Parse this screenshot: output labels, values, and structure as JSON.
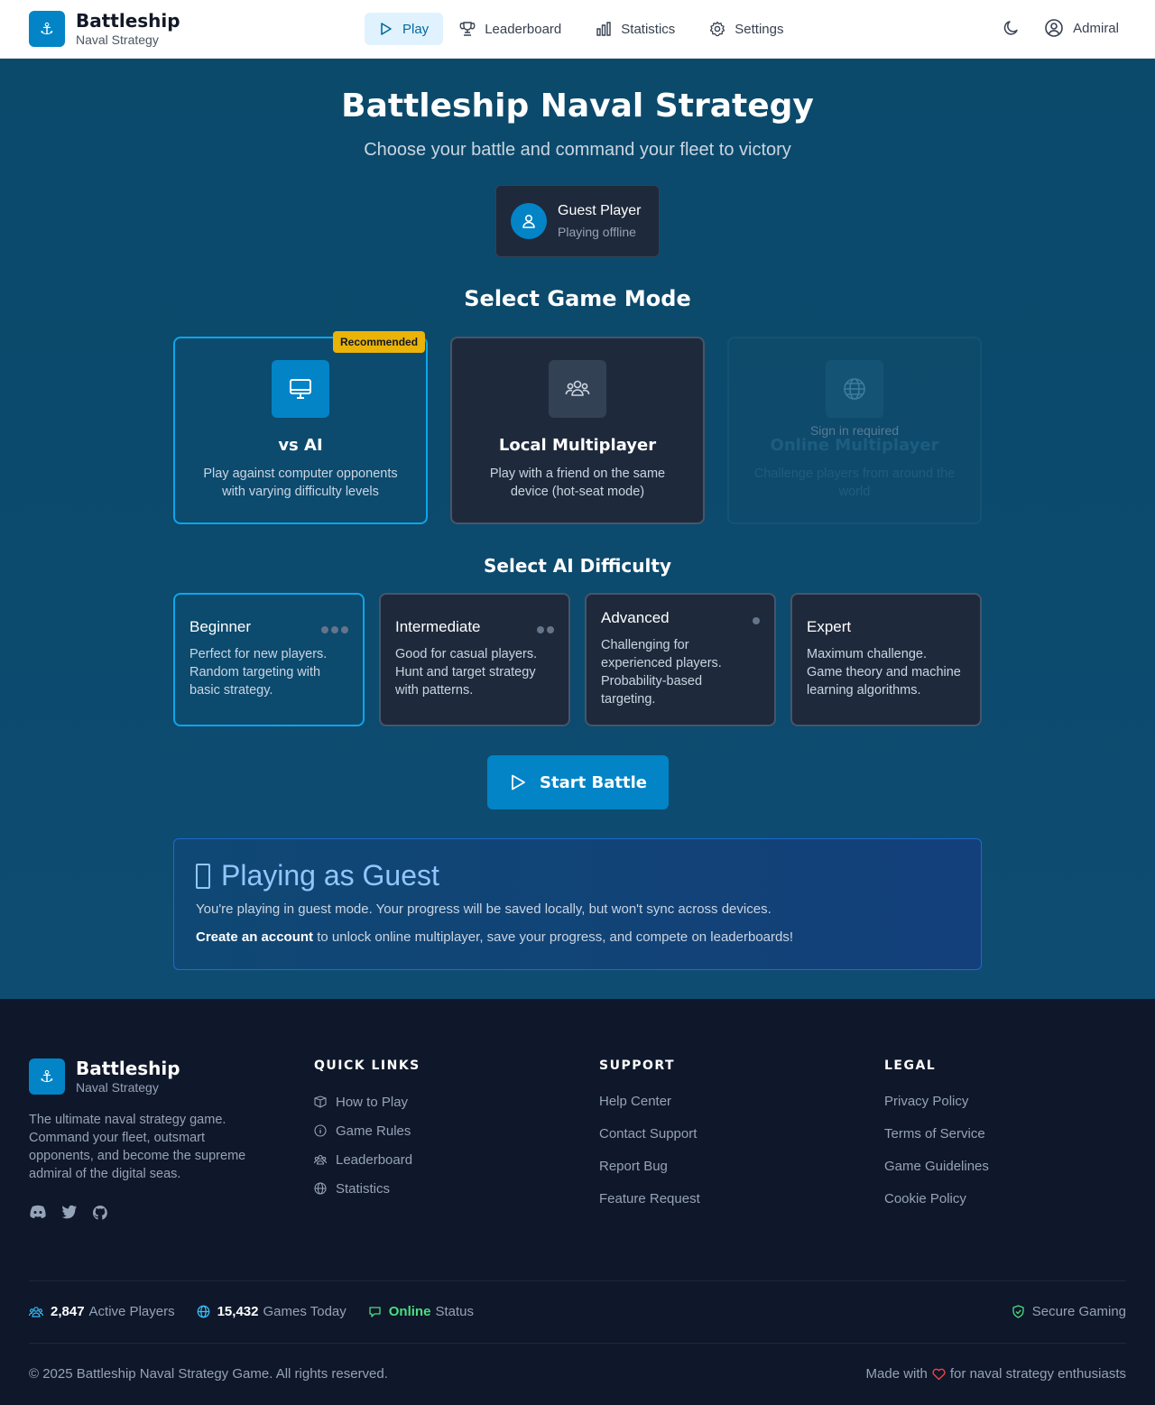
{
  "header": {
    "brand_title": "Battleship",
    "brand_sub": "Naval Strategy",
    "logo_glyph": "⚓",
    "nav": [
      {
        "label": "Play",
        "icon": "play-icon",
        "active": true
      },
      {
        "label": "Leaderboard",
        "icon": "trophy-icon"
      },
      {
        "label": "Statistics",
        "icon": "bar-chart-icon"
      },
      {
        "label": "Settings",
        "icon": "gear-icon"
      }
    ],
    "user_label": "Admiral"
  },
  "hero": {
    "title": "Battleship Naval Strategy",
    "subtitle": "Choose your battle and command your fleet to victory"
  },
  "guest": {
    "name": "Guest Player",
    "status": "Playing offline"
  },
  "modes_title": "Select Game Mode",
  "modes": [
    {
      "title": "vs AI",
      "desc": "Play against computer opponents with varying difficulty levels",
      "badge": "Recommended",
      "icon": "monitor-icon",
      "selected": true
    },
    {
      "title": "Local Multiplayer",
      "desc": "Play with a friend on the same device (hot-seat mode)",
      "icon": "users-icon"
    },
    {
      "title": "Online Multiplayer",
      "desc": "Challenge players from around the world",
      "note": "Sign in required",
      "icon": "globe-icon",
      "disabled": true
    }
  ],
  "difficulty_title": "Select AI Difficulty",
  "difficulties": [
    {
      "name": "Beginner",
      "desc": "Perfect for new players. Random targeting with basic strategy.",
      "dots": 3,
      "selected": true
    },
    {
      "name": "Intermediate",
      "desc": "Good for casual players. Hunt and target strategy with patterns.",
      "dots": 2
    },
    {
      "name": "Advanced",
      "desc": "Challenging for experienced players. Probability-based targeting.",
      "dots": 1
    },
    {
      "name": "Expert",
      "desc": "Maximum challenge. Game theory and machine learning algorithms.",
      "dots": 0
    }
  ],
  "start_button": "Start Battle",
  "info": {
    "title": "Playing as Guest",
    "line1": "You're playing in guest mode. Your progress will be saved locally, but won't sync across devices.",
    "link": "Create an account",
    "line2_rest": " to unlock online multiplayer, save your progress, and compete on leaderboards!"
  },
  "footer": {
    "brand_title": "Battleship",
    "brand_sub": "Naval Strategy",
    "desc": "The ultimate naval strategy game. Command your fleet, outsmart opponents, and become the supreme admiral of the digital seas.",
    "socials": [
      "discord-icon",
      "twitter-icon",
      "github-icon"
    ],
    "quick_links_title": "QUICK LINKS",
    "quick_links": [
      {
        "label": "How to Play",
        "icon": "book-icon"
      },
      {
        "label": "Game Rules",
        "icon": "info-icon"
      },
      {
        "label": "Leaderboard",
        "icon": "users-icon"
      },
      {
        "label": "Statistics",
        "icon": "globe-icon"
      }
    ],
    "support_title": "SUPPORT",
    "support": [
      "Help Center",
      "Contact Support",
      "Report Bug",
      "Feature Request"
    ],
    "legal_title": "LEGAL",
    "legal": [
      "Privacy Policy",
      "Terms of Service",
      "Game Guidelines",
      "Cookie Policy"
    ],
    "stats": {
      "players_value": "2,847",
      "players_label": "Active Players",
      "games_value": "15,432",
      "games_label": "Games Today",
      "online_value": "Online",
      "online_label": "Status"
    },
    "secure": "Secure Gaming",
    "copyright": "© 2025 Battleship Naval Strategy Game. All rights reserved.",
    "made_prefix": "Made with",
    "made_suffix": "for naval strategy enthusiasts"
  },
  "colors": {
    "accent": "#0284c7",
    "badge": "#eab308",
    "online": "#4ade80",
    "heart": "#ef4444"
  }
}
